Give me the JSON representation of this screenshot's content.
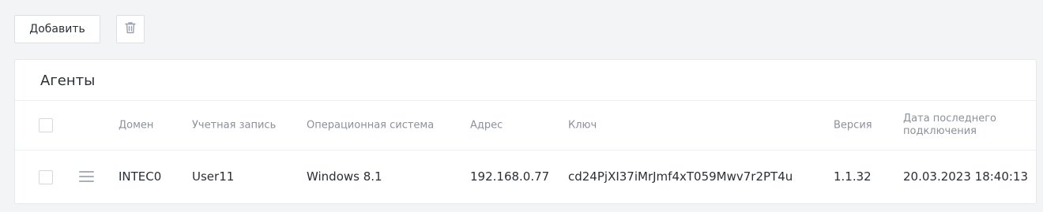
{
  "toolbar": {
    "add_label": "Добавить",
    "delete_icon": "trash-icon"
  },
  "panel": {
    "title": "Агенты"
  },
  "table": {
    "columns": {
      "domain": "Домен",
      "account": "Учетная запись",
      "os": "Операционная система",
      "address": "Адрес",
      "key": "Ключ",
      "version": "Версия",
      "last_connection": "Дата последнего подключения"
    },
    "rows": [
      {
        "domain": "INTEC0",
        "account": "User11",
        "os": "Windows 8.1",
        "address": "192.168.0.77",
        "key": "cd24PjXI37iMrJmf4xT059Mwv7r2PT4u",
        "version": "1.1.32",
        "last_connection": "20.03.2023 18:40:13"
      }
    ]
  },
  "colors": {
    "background": "#f3f4f6",
    "panel": "#ffffff",
    "header_text": "#8b9099",
    "body_text": "#2b2f36",
    "border": "#dcdfe4"
  }
}
